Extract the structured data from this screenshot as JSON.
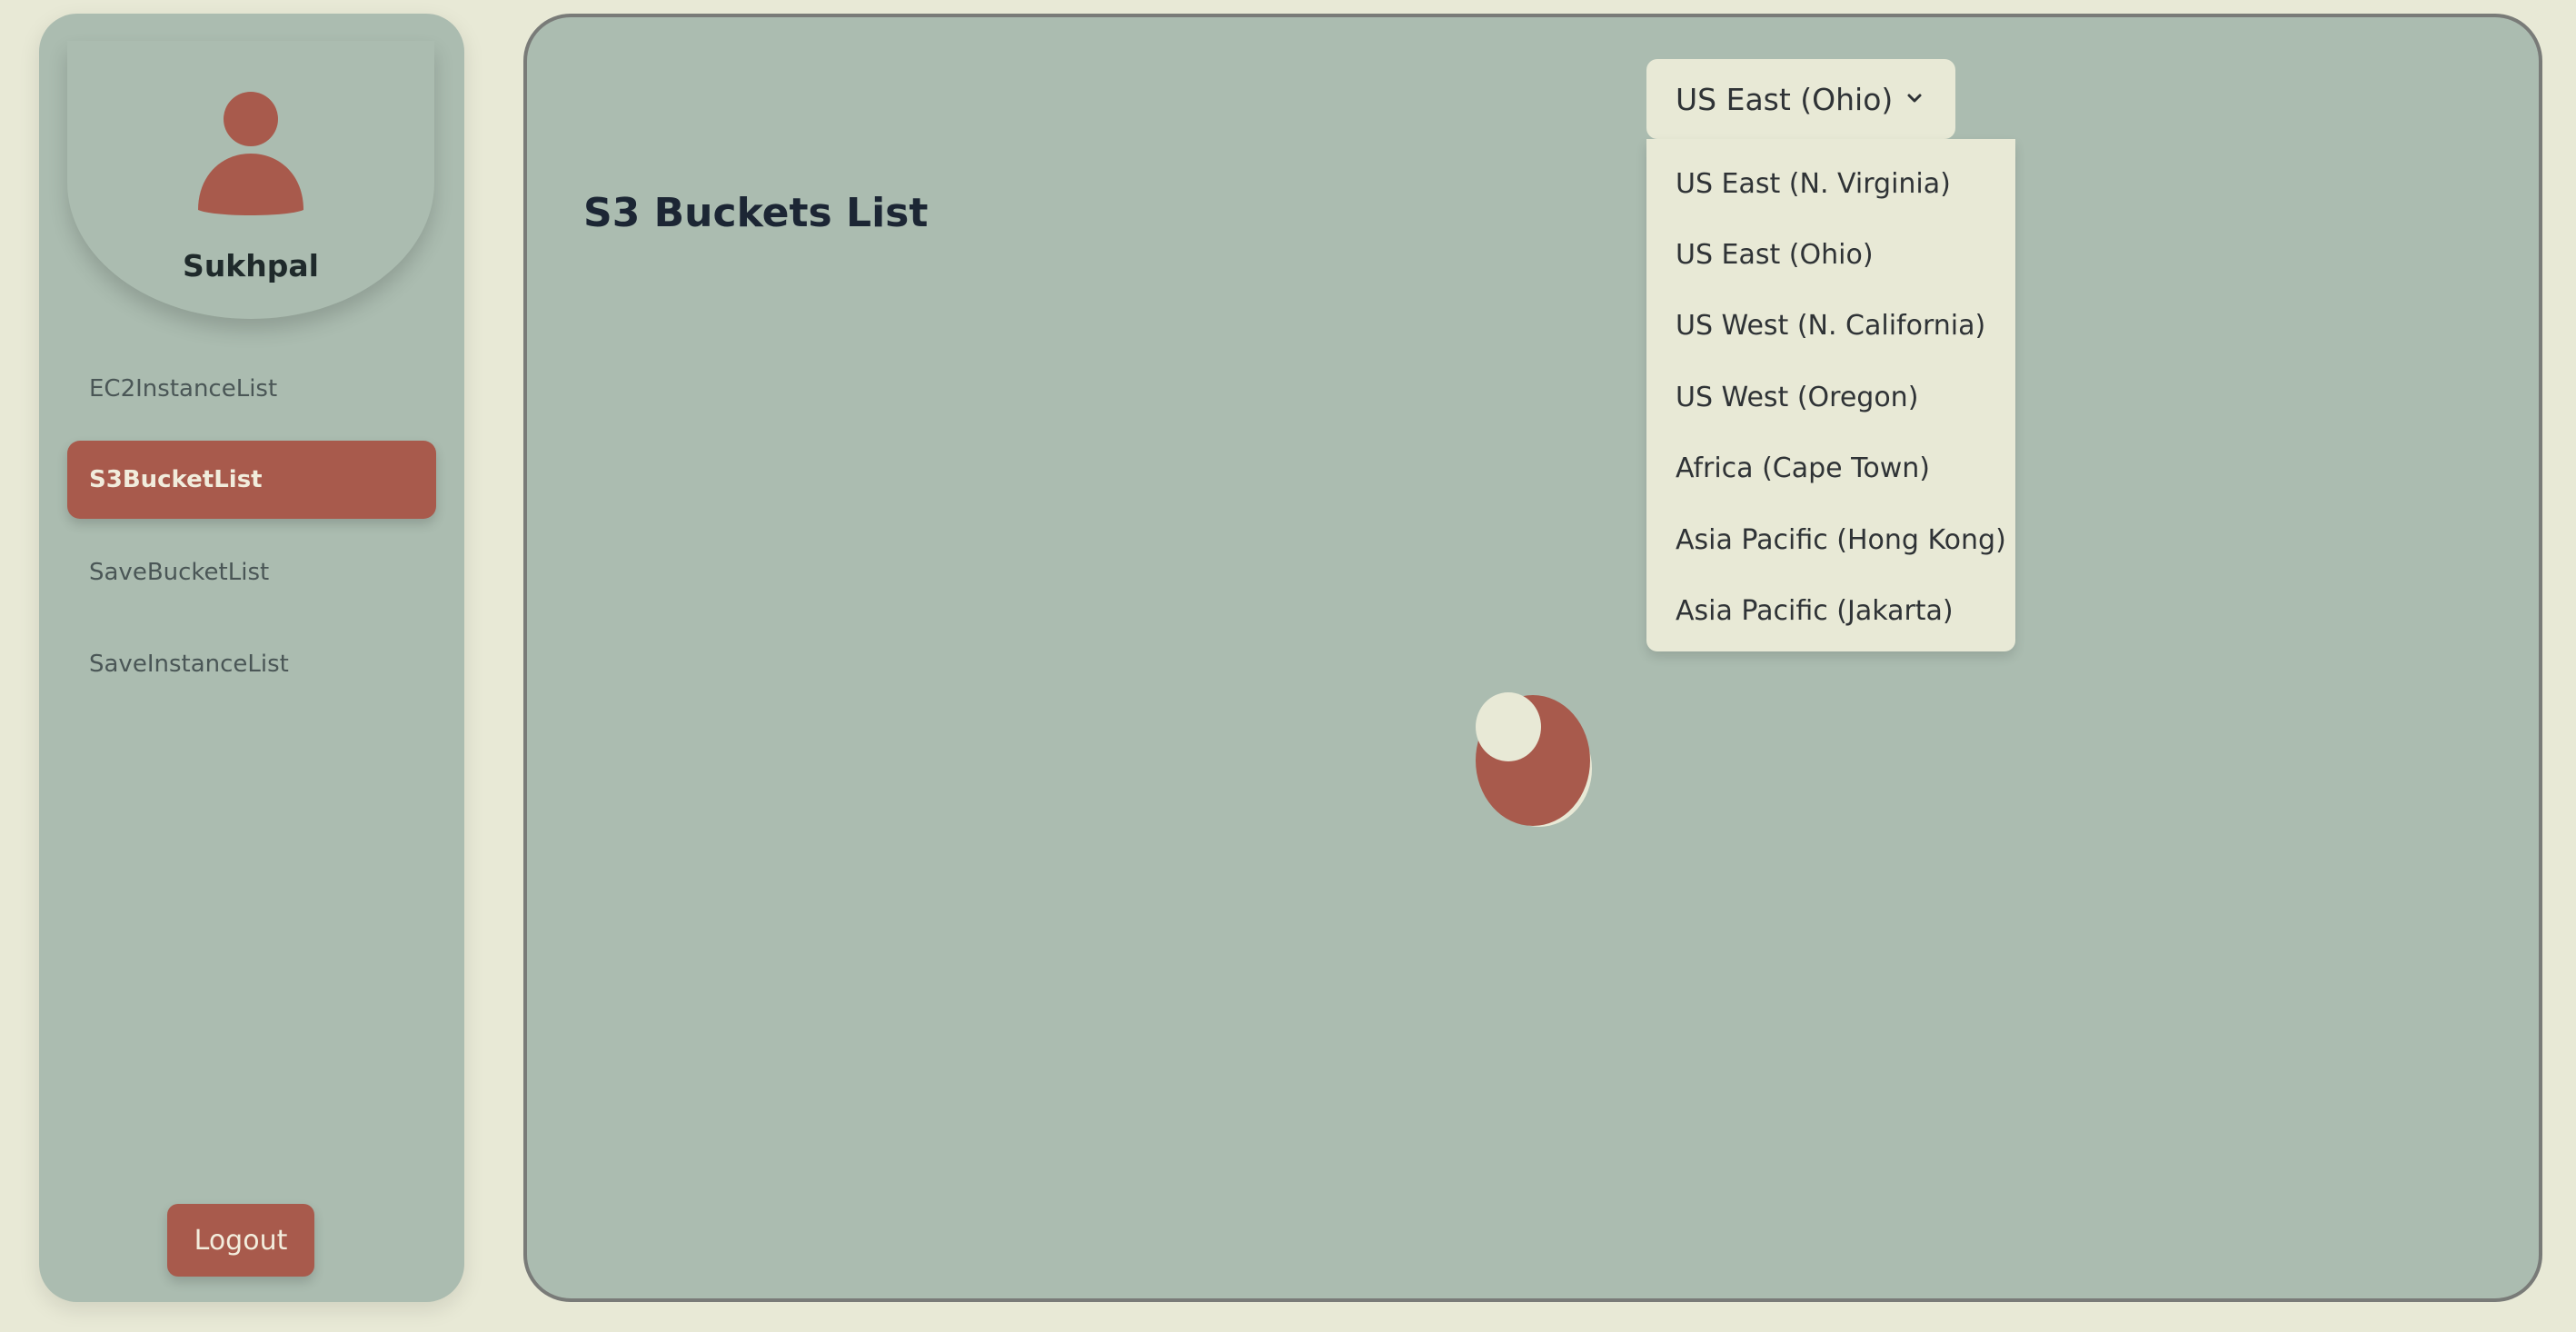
{
  "user": {
    "name": "Sukhpal"
  },
  "sidebar": {
    "items": [
      {
        "label": "EC2InstanceList",
        "active": false
      },
      {
        "label": "S3BucketList",
        "active": true
      },
      {
        "label": "SaveBucketList",
        "active": false
      },
      {
        "label": "SaveInstanceList",
        "active": false
      }
    ],
    "logout_label": "Logout"
  },
  "main": {
    "title": "S3 Buckets List",
    "loading": true
  },
  "region": {
    "selected": "US East (Ohio)",
    "options": [
      "US East (N. Virginia)",
      "US East (Ohio)",
      "US West (N. California)",
      "US West (Oregon)",
      "Africa (Cape Town)",
      "Asia Pacific (Hong Kong)",
      "Asia Pacific (Jakarta)"
    ]
  },
  "icons": {
    "avatar": "user-icon",
    "select": "chevron-down-icon",
    "loader": "loading-spinner-icon"
  },
  "colors": {
    "page_bg": "#e8e9d6",
    "panel_bg": "#abbcb0",
    "accent": "#a85a4c",
    "text_dark": "#1c2634",
    "border": "#797b78"
  }
}
